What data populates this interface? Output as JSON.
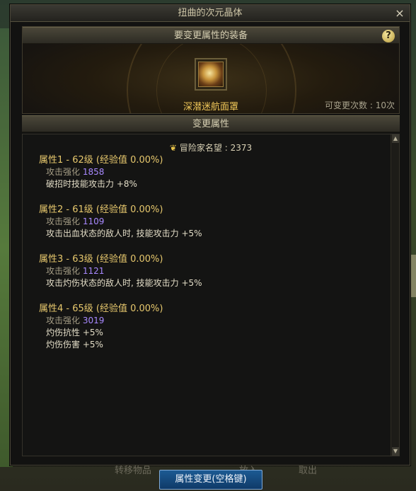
{
  "window": {
    "title": "扭曲的次元晶体",
    "close_label": "×"
  },
  "equip_section": {
    "header": "要变更属性的装备",
    "help_label": "?",
    "item_name": "深潜迷航面罩",
    "change_count": "可变更次数 : 10次"
  },
  "attr_section": {
    "header": "变更属性",
    "fame_label": "冒险家名望",
    "fame_value": ": 2373",
    "attributes": [
      {
        "title": "属性1 - 62级 (经验值 0.00%)",
        "boost_label": "攻击强化",
        "boost_value": "1858",
        "effects": [
          "破招时技能攻击力 +8%"
        ]
      },
      {
        "title": "属性2 - 61级 (经验值 0.00%)",
        "boost_label": "攻击强化",
        "boost_value": "1109",
        "effects": [
          "攻击出血状态的敌人时, 技能攻击力 +5%"
        ]
      },
      {
        "title": "属性3 - 63级 (经验值 0.00%)",
        "boost_label": "攻击强化",
        "boost_value": "1121",
        "effects": [
          "攻击灼伤状态的敌人时, 技能攻击力 +5%"
        ]
      },
      {
        "title": "属性4 - 65级 (经验值 0.00%)",
        "boost_label": "攻击强化",
        "boost_value": "3019",
        "effects": [
          "灼伤抗性 +5%",
          "灼伤伤害 +5%"
        ]
      }
    ]
  },
  "background_ui": {
    "left_label": "转移物品",
    "middle_label": "放入",
    "right_label": "取出"
  },
  "main_button": {
    "label": "属性变更(空格键)"
  },
  "colors": {
    "item_name": "#f2c95a",
    "attr_title": "#e7c86d",
    "boost_value": "#a889ff",
    "main_button": "#1c5a93"
  }
}
